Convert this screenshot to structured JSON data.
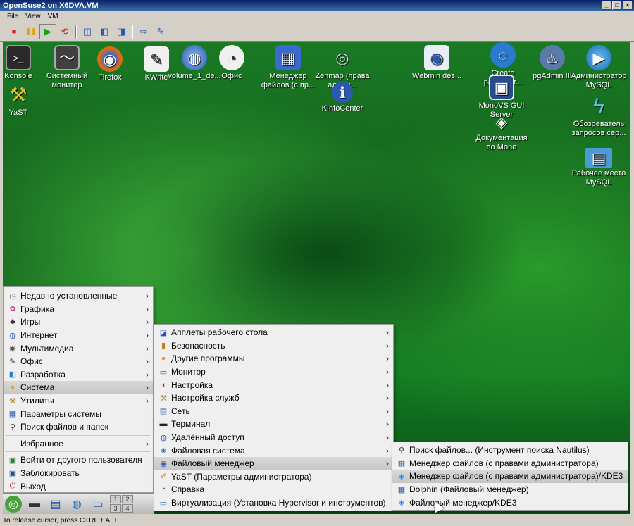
{
  "window": {
    "title": "OpenSuse2 on X6DVA.VM",
    "min": "_",
    "max": "□",
    "close": "×"
  },
  "menubar": [
    "File",
    "View",
    "VM"
  ],
  "toolbar": {
    "stop": "■",
    "pause": "❚❚",
    "play": "▶",
    "reset": "⟲",
    "snap1": "◫",
    "snap2": "◧",
    "snap3": "◨",
    "send": "⇨",
    "tools": "✎"
  },
  "colors": {
    "stop": "#d42020",
    "pause": "#e0a010",
    "play": "#18a018",
    "reset": "#c03020"
  },
  "desktop_icons": [
    {
      "label": "Konsole",
      "glyph": ">_",
      "color": "#2a2a2a"
    },
    {
      "label": "Системный монитор",
      "glyph": "〜",
      "color": "#404040"
    },
    {
      "label": "Firefox",
      "glyph": "◉",
      "color": "#e06a10"
    },
    {
      "label": "KWrite",
      "glyph": "✎",
      "color": "#f0f0f0"
    },
    {
      "label": "volume_1_de...",
      "glyph": "◍",
      "color": "#3a7ad0"
    },
    {
      "label": "Офис",
      "glyph": "◔",
      "color": "#f0f0f0"
    },
    {
      "label": "Менеджер файлов (с пр...",
      "glyph": "▦",
      "color": "#3a6ad0"
    },
    {
      "label": "Zenmap (права админ...",
      "glyph": "◎",
      "color": "#d0d8e8"
    },
    {
      "label": "KInfoCenter",
      "glyph": "ℹ",
      "color": "#2a5ab0"
    },
    {
      "label": "Webmin des...",
      "glyph": "◉",
      "color": "#e8ecf4"
    },
    {
      "label": "Create разработ...",
      "glyph": "◌",
      "color": "#2a7ad0"
    },
    {
      "label": "MonoVS GUI Server",
      "glyph": "▣",
      "color": "#2a4a8a"
    },
    {
      "label": "Документация по Mono",
      "glyph": "◈",
      "color": "#f0f0f0"
    },
    {
      "label": "pgAdmin III",
      "glyph": "♨",
      "color": "#5a7aa8"
    },
    {
      "label": "Администратор MySQL",
      "glyph": "▶",
      "color": "#2a8ad0"
    },
    {
      "label": "Обозреватель запросов сер...",
      "glyph": "ϟ",
      "color": "#1a9ae0"
    },
    {
      "label": "Рабочее место MySQL",
      "glyph": "▤",
      "color": "#4a9ad8"
    },
    {
      "label": "YaST",
      "glyph": "⚒",
      "color": "#d8b020"
    }
  ],
  "main_menu": [
    {
      "label": "Недавно установленные",
      "icon": "◷",
      "arrow": "›"
    },
    {
      "label": "Графика",
      "icon": "✿",
      "arrow": "›"
    },
    {
      "label": "Игры",
      "icon": "♣",
      "arrow": "›"
    },
    {
      "label": "Интернет",
      "icon": "◍",
      "arrow": "›"
    },
    {
      "label": "Мультимедиа",
      "icon": "◉",
      "arrow": "›"
    },
    {
      "label": "Офис",
      "icon": "✎",
      "arrow": "›"
    },
    {
      "label": "Разработка",
      "icon": "◧",
      "arrow": "›"
    },
    {
      "label": "Система",
      "icon": "●",
      "arrow": "›"
    },
    {
      "label": "Утилиты",
      "icon": "⚒",
      "arrow": "›"
    },
    {
      "label": "Параметры системы",
      "icon": "▦",
      "arrow": ""
    },
    {
      "label": "Поиск файлов и папок",
      "icon": "⚲",
      "arrow": ""
    },
    {
      "label": "Избранное",
      "icon": "",
      "arrow": "›"
    },
    {
      "label": "Войти от другого пользователя",
      "icon": "▣",
      "arrow": ""
    },
    {
      "label": "Заблокировать",
      "icon": "▣",
      "arrow": ""
    },
    {
      "label": "Выход",
      "icon": "⏻",
      "arrow": ""
    }
  ],
  "system_menu": [
    {
      "label": "Апплеты рабочего стола",
      "icon": "◪",
      "arrow": "›"
    },
    {
      "label": "Безопасность",
      "icon": "▮",
      "arrow": "›"
    },
    {
      "label": "Другие программы",
      "icon": "◕",
      "arrow": "›"
    },
    {
      "label": "Монитор",
      "icon": "▭",
      "arrow": "›"
    },
    {
      "label": "Настройка",
      "icon": "◖",
      "arrow": "›"
    },
    {
      "label": "Настройка служб",
      "icon": "⚒",
      "arrow": "›"
    },
    {
      "label": "Сеть",
      "icon": "▤",
      "arrow": "›"
    },
    {
      "label": "Терминал",
      "icon": "▬",
      "arrow": "›"
    },
    {
      "label": "Удалённый доступ",
      "icon": "◍",
      "arrow": "›"
    },
    {
      "label": "Файловая система",
      "icon": "◈",
      "arrow": "›"
    },
    {
      "label": "Файловый менеджер",
      "icon": "◉",
      "arrow": "›"
    },
    {
      "label": "YaST (Параметры администратора)",
      "icon": "✐",
      "arrow": ""
    },
    {
      "label": "Справка",
      "icon": "◔",
      "arrow": ""
    },
    {
      "label": "Виртуализация (Установка Hypervisor и инструментов)",
      "icon": "▭",
      "arrow": ""
    }
  ],
  "fm_menu": [
    {
      "label": "Поиск файлов... (Инструмент поиска Nautilus)",
      "icon": "⚲"
    },
    {
      "label": "Менеджер файлов (с правами администратора)",
      "icon": "▦"
    },
    {
      "label": "Менеджер файлов (с правами администратора)/KDE3",
      "icon": "◈"
    },
    {
      "label": "Dolphin (Файловый менеджер)",
      "icon": "▦"
    },
    {
      "label": "Файловый менеджер/KDE3",
      "icon": "◈"
    }
  ],
  "taskbar": {
    "start": "◎",
    "t1": "▬",
    "t2": "▤",
    "t3": "◍",
    "t4": "▭",
    "pager": [
      "1",
      "2",
      "3",
      "4"
    ]
  },
  "status": "To release cursor, press CTRL + ALT"
}
